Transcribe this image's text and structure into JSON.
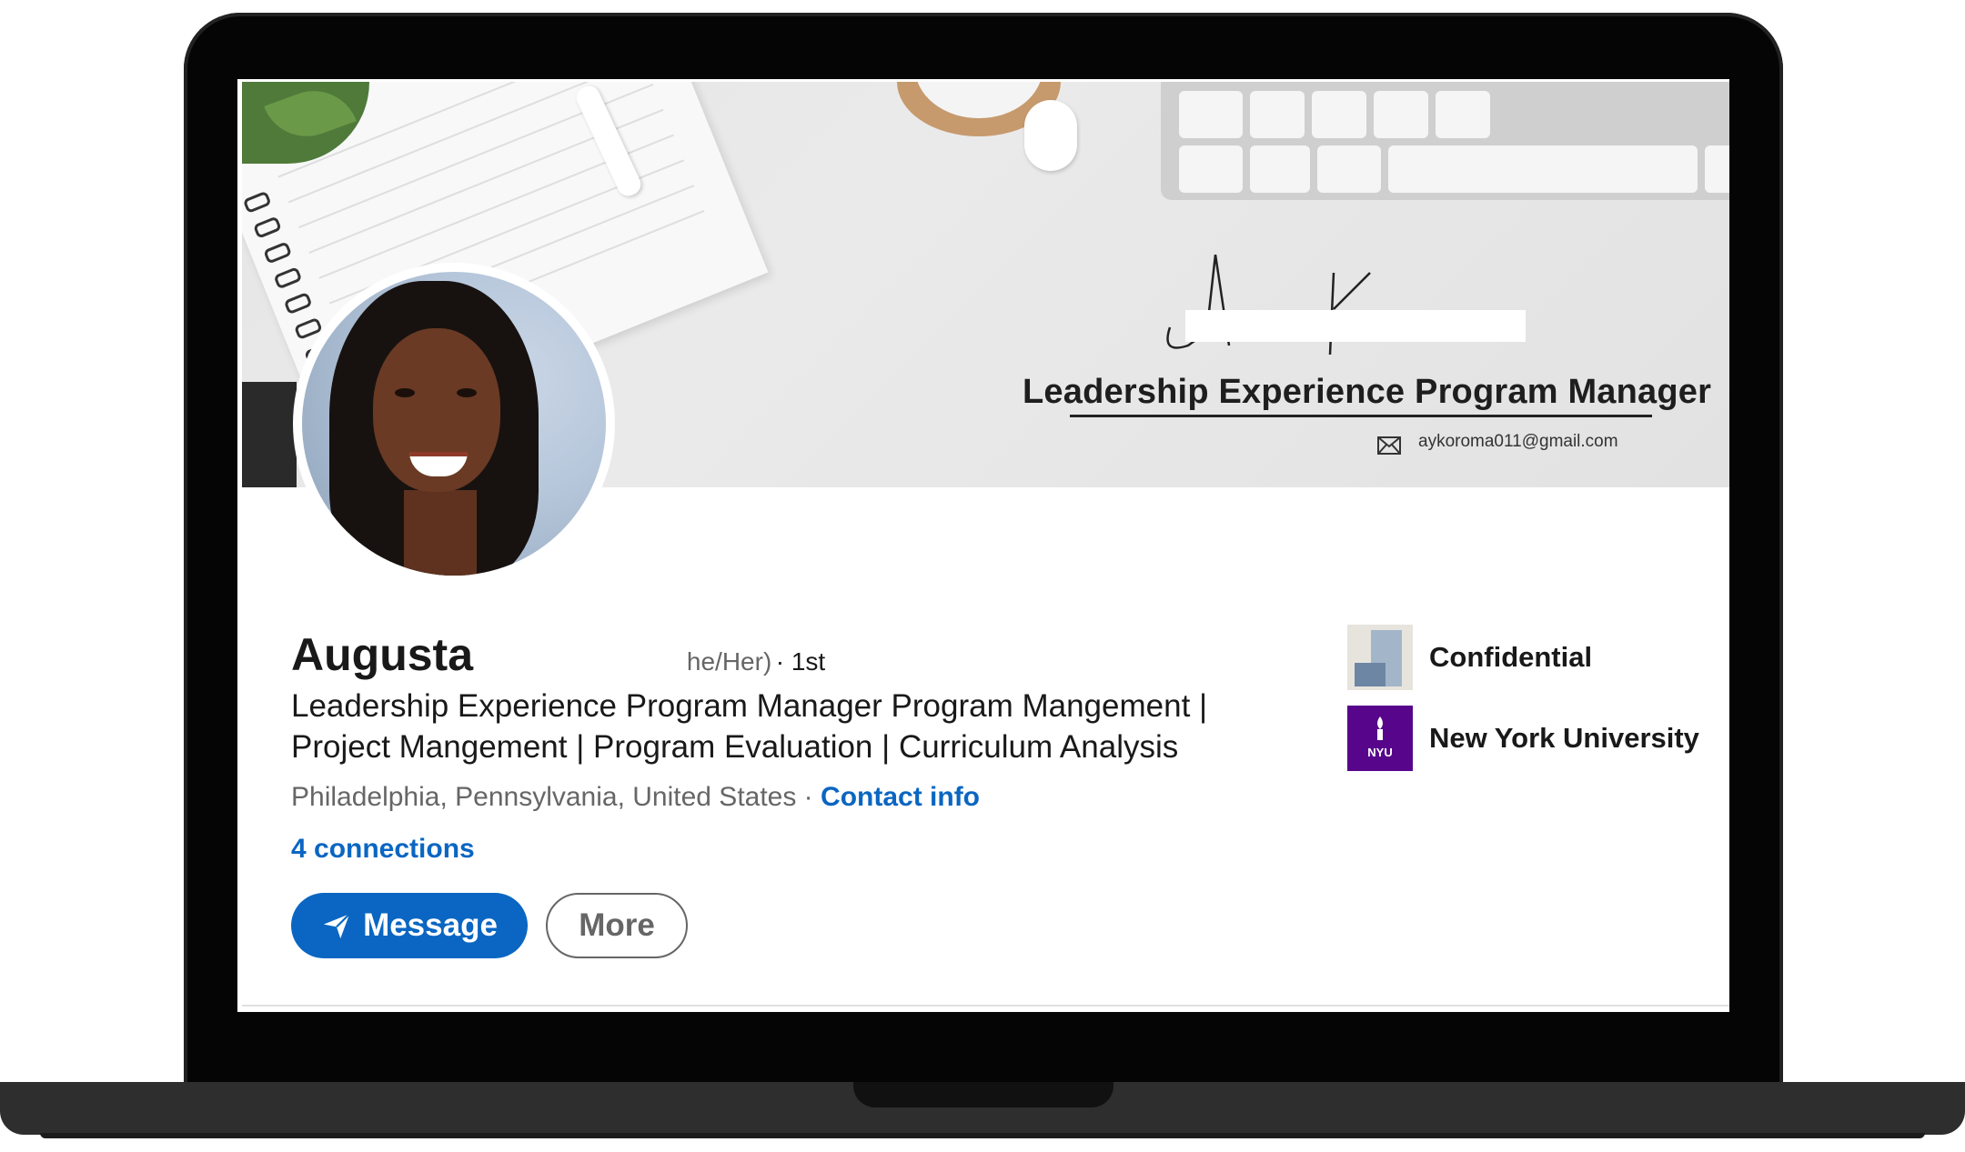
{
  "banner": {
    "title": "Leadership Experience Program Manager",
    "email": "aykoroma011@gmail.com",
    "email_icon": "envelope-icon"
  },
  "profile": {
    "name": "Augusta",
    "pronouns": "he/Her)",
    "degree": "· 1st",
    "headline": "Leadership Experience Program Manager Program Mangement | Project Mangement | Program Evaluation | Curriculum Analysis",
    "location": "Philadelphia, Pennsylvania, United States ·",
    "contact_link": "Contact info",
    "connections": "4 connections"
  },
  "actions": {
    "message_label": "Message",
    "message_icon": "send-icon",
    "more_label": "More"
  },
  "experience": [
    {
      "label": "Confidential",
      "logo": "company-logo"
    },
    {
      "label": "New York University",
      "logo": "nyu-logo",
      "logo_text": "NYU"
    }
  ],
  "colors": {
    "accent": "#0a66c2",
    "text": "#191919",
    "muted": "#666666",
    "nyu_purple": "#57068c"
  }
}
